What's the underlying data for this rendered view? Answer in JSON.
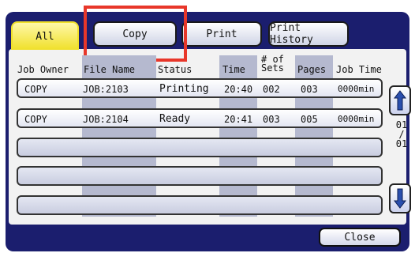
{
  "tabs": [
    {
      "label": "All",
      "active": true
    },
    {
      "label": "Copy",
      "active": false
    },
    {
      "label": "Print",
      "active": false
    },
    {
      "label": "Print History",
      "active": false
    }
  ],
  "columns": {
    "job_owner": "Job Owner",
    "file_name": "File Name",
    "status": "Status",
    "time": "Time",
    "sets_line1": "# of",
    "sets_line2": "Sets",
    "pages": "Pages",
    "job_time": "Job Time"
  },
  "rows": [
    {
      "owner": "COPY",
      "file": "JOB:2103",
      "status": "Printing",
      "time": "20:40",
      "sets": "002",
      "pages": "003",
      "job_time": "0000min"
    },
    {
      "owner": "COPY",
      "file": "JOB:2104",
      "status": "Ready",
      "time": "20:41",
      "sets": "003",
      "pages": "005",
      "job_time": "0000min"
    }
  ],
  "pager": {
    "current": "01",
    "separator": "/",
    "total": "01"
  },
  "close_label": "Close",
  "colors": {
    "frame": "#1b1e6e",
    "active_tab": "#f0e02a",
    "highlight": "#e8372a",
    "scroll_arrow": "#2a4fae"
  }
}
